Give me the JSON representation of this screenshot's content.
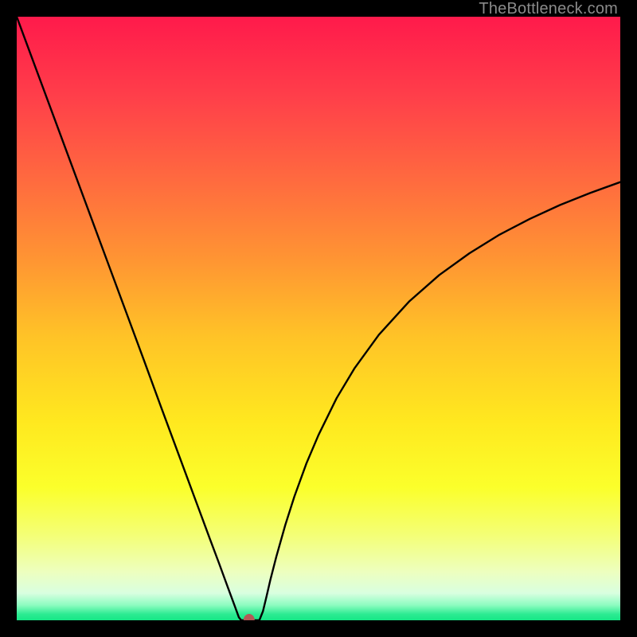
{
  "watermark": "TheBottleneck.com",
  "chart_data": {
    "type": "line",
    "title": "",
    "xlabel": "",
    "ylabel": "",
    "xlim": [
      0,
      1
    ],
    "ylim": [
      0,
      100
    ],
    "grid": false,
    "legend": false,
    "background_gradient": {
      "stops": [
        {
          "offset": 0.0,
          "color": "#ff1a4b"
        },
        {
          "offset": 0.13,
          "color": "#ff3e4a"
        },
        {
          "offset": 0.27,
          "color": "#ff6a3f"
        },
        {
          "offset": 0.4,
          "color": "#ff9433"
        },
        {
          "offset": 0.53,
          "color": "#ffc327"
        },
        {
          "offset": 0.67,
          "color": "#ffe81f"
        },
        {
          "offset": 0.78,
          "color": "#fbff2b"
        },
        {
          "offset": 0.86,
          "color": "#f4ff77"
        },
        {
          "offset": 0.92,
          "color": "#edffbf"
        },
        {
          "offset": 0.955,
          "color": "#d9ffe0"
        },
        {
          "offset": 0.975,
          "color": "#8cfcc0"
        },
        {
          "offset": 0.99,
          "color": "#2ceb92"
        },
        {
          "offset": 1.0,
          "color": "#16e786"
        }
      ]
    },
    "series": [
      {
        "name": "bottleneck-curve",
        "color": "#000000",
        "x": [
          0.0,
          0.03,
          0.06,
          0.09,
          0.12,
          0.15,
          0.18,
          0.21,
          0.24,
          0.27,
          0.3,
          0.32,
          0.335,
          0.35,
          0.36,
          0.368,
          0.372,
          0.376,
          0.38,
          0.39,
          0.402,
          0.408,
          0.414,
          0.42,
          0.43,
          0.445,
          0.46,
          0.48,
          0.5,
          0.53,
          0.56,
          0.6,
          0.65,
          0.7,
          0.75,
          0.8,
          0.85,
          0.9,
          0.95,
          1.0
        ],
        "y": [
          100.0,
          91.9,
          83.8,
          75.7,
          67.6,
          59.5,
          51.4,
          43.3,
          35.1,
          27.0,
          18.9,
          13.5,
          9.5,
          5.4,
          2.7,
          0.5,
          0.0,
          0.0,
          0.0,
          0.0,
          0.0,
          1.5,
          4.0,
          6.6,
          10.5,
          15.8,
          20.5,
          26.0,
          30.7,
          36.8,
          41.8,
          47.3,
          52.8,
          57.2,
          60.8,
          63.9,
          66.5,
          68.8,
          70.8,
          72.6
        ]
      }
    ],
    "marker": {
      "x": 0.385,
      "y": 0.0,
      "color": "#b35a57",
      "radius_px": 7
    }
  }
}
